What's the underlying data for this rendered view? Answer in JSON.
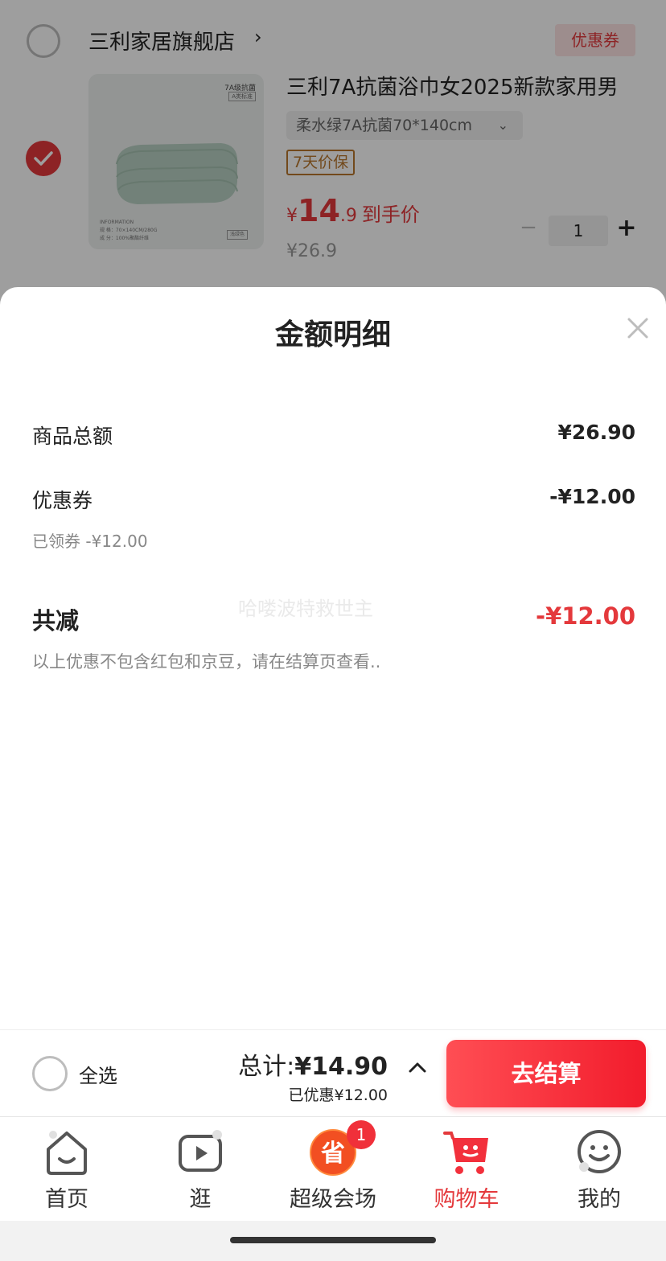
{
  "cart": {
    "store": {
      "name": "三利家居旗舰店",
      "chevron": "›",
      "coupon_tag": "优惠券"
    },
    "item": {
      "title": "三利7A抗菌浴巾女2025新款家用男",
      "sku": "柔水绿7A抗菌70*140cm",
      "sku_caret": "⌄",
      "guarantee": "7天价保",
      "price_symbol": "¥",
      "price_int": "14",
      "price_dec": ".9",
      "price_label": "到手价",
      "original_price": "¥26.9",
      "quantity": "1",
      "minus": "−",
      "plus": "+",
      "image": {
        "tag_main": "7A级抗菌",
        "tag_sub": "A类标准",
        "info_title": "INFORMATION",
        "info_line1": "规  格：70×140CM/280G",
        "info_line2": "成  分：100%聚酯纤维",
        "color_tag": "浅绿色"
      }
    }
  },
  "sheet": {
    "title": "金额明细",
    "rows": {
      "goods_total_label": "商品总额",
      "goods_total_value": "¥26.90",
      "coupon_label": "优惠券",
      "coupon_value": "-¥12.00",
      "coupon_sub": "已领券 -¥12.00",
      "total_reduce_label": "共减",
      "total_reduce_value": "-¥12.00"
    },
    "watermark": "哈喽波特救世主",
    "disclaimer": "以上优惠不包含红包和京豆，请在结算页查看.."
  },
  "checkout": {
    "select_all": "全选",
    "total_prefix": "总计:",
    "total_amount": "¥14.90",
    "saved": "已优惠¥12.00",
    "button": "去结算"
  },
  "tabs": [
    {
      "label": "首页",
      "icon": "home-icon"
    },
    {
      "label": "逛",
      "icon": "video-icon"
    },
    {
      "label": "超级会场",
      "icon": "save-icon",
      "badge": "1",
      "glyph": "省"
    },
    {
      "label": "购物车",
      "icon": "cart-icon",
      "active": true
    },
    {
      "label": "我的",
      "icon": "profile-icon"
    }
  ],
  "colors": {
    "accent": "#e4393c",
    "checkout_button": "#f21c2c",
    "guarantee": "#b8762d"
  }
}
